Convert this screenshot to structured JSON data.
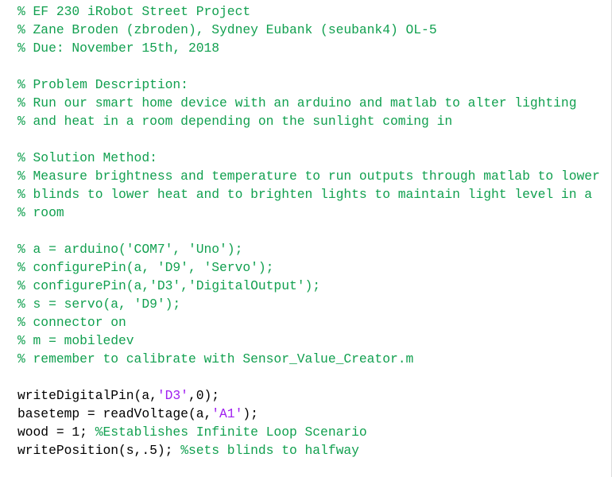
{
  "editor": {
    "language": "matlab",
    "background_color": "#ffffff",
    "comment_color": "#12a050",
    "string_color": "#a020f0",
    "plain_color": "#000000",
    "lines": [
      {
        "tokens": [
          {
            "type": "comment",
            "text": "% EF 230 iRobot Street Project"
          }
        ]
      },
      {
        "tokens": [
          {
            "type": "comment",
            "text": "% Zane Broden (zbroden), Sydney Eubank (seubank4) OL-5"
          }
        ]
      },
      {
        "tokens": [
          {
            "type": "comment",
            "text": "% Due: November 15th, 2018"
          }
        ]
      },
      {
        "tokens": [
          {
            "type": "plain",
            "text": ""
          }
        ]
      },
      {
        "tokens": [
          {
            "type": "comment",
            "text": "% Problem Description:"
          }
        ]
      },
      {
        "tokens": [
          {
            "type": "comment",
            "text": "% Run our smart home device with an arduino and matlab to alter lighting"
          }
        ]
      },
      {
        "tokens": [
          {
            "type": "comment",
            "text": "% and heat in a room depending on the sunlight coming in"
          }
        ]
      },
      {
        "tokens": [
          {
            "type": "plain",
            "text": ""
          }
        ]
      },
      {
        "tokens": [
          {
            "type": "comment",
            "text": "% Solution Method:"
          }
        ]
      },
      {
        "tokens": [
          {
            "type": "comment",
            "text": "% Measure brightness and temperature to run outputs through matlab to lower"
          }
        ]
      },
      {
        "tokens": [
          {
            "type": "comment",
            "text": "% blinds to lower heat and to brighten lights to maintain light level in a"
          }
        ]
      },
      {
        "tokens": [
          {
            "type": "comment",
            "text": "% room"
          }
        ]
      },
      {
        "tokens": [
          {
            "type": "plain",
            "text": ""
          }
        ]
      },
      {
        "tokens": [
          {
            "type": "comment",
            "text": "% a = arduino('COM7', 'Uno');"
          }
        ]
      },
      {
        "tokens": [
          {
            "type": "comment",
            "text": "% configurePin(a, 'D9', 'Servo');"
          }
        ]
      },
      {
        "tokens": [
          {
            "type": "comment",
            "text": "% configurePin(a,'D3','DigitalOutput');"
          }
        ]
      },
      {
        "tokens": [
          {
            "type": "comment",
            "text": "% s = servo(a, 'D9');"
          }
        ]
      },
      {
        "tokens": [
          {
            "type": "comment",
            "text": "% connector on"
          }
        ]
      },
      {
        "tokens": [
          {
            "type": "comment",
            "text": "% m = mobiledev"
          }
        ]
      },
      {
        "tokens": [
          {
            "type": "comment",
            "text": "% remember to calibrate with Sensor_Value_Creator.m"
          }
        ]
      },
      {
        "tokens": [
          {
            "type": "plain",
            "text": ""
          }
        ]
      },
      {
        "tokens": [
          {
            "type": "plain",
            "text": "writeDigitalPin(a,"
          },
          {
            "type": "string",
            "text": "'D3'"
          },
          {
            "type": "plain",
            "text": ",0);"
          }
        ]
      },
      {
        "tokens": [
          {
            "type": "plain",
            "text": "basetemp = readVoltage(a,"
          },
          {
            "type": "string",
            "text": "'A1'"
          },
          {
            "type": "plain",
            "text": ");"
          }
        ]
      },
      {
        "tokens": [
          {
            "type": "plain",
            "text": "wood = 1; "
          },
          {
            "type": "comment",
            "text": "%Establishes Infinite Loop Scenario"
          }
        ]
      },
      {
        "tokens": [
          {
            "type": "plain",
            "text": "writePosition(s,.5); "
          },
          {
            "type": "comment",
            "text": "%sets blinds to halfway"
          }
        ]
      }
    ]
  }
}
